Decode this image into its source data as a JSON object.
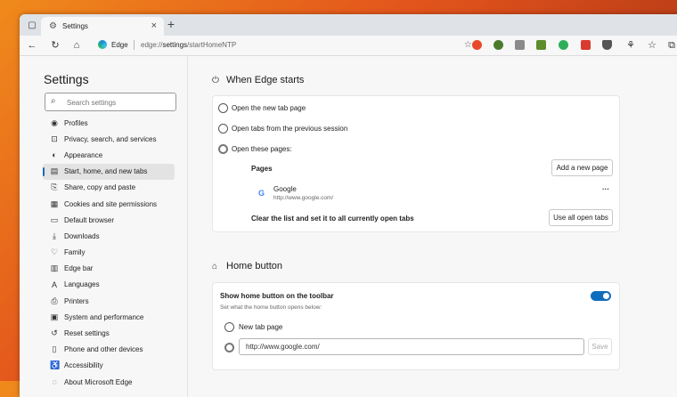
{
  "browser": {
    "tab_title": "Settings",
    "omnibox_label": "Edge",
    "url_scheme": "edge://",
    "url_host": "settings",
    "url_path": "/startHomeNTP"
  },
  "sidebar": {
    "title": "Settings",
    "search_placeholder": "Search settings",
    "items": [
      {
        "label": "Profiles",
        "icon": "profile-icon"
      },
      {
        "label": "Privacy, search, and services",
        "icon": "lock-icon"
      },
      {
        "label": "Appearance",
        "icon": "appearance-icon"
      },
      {
        "label": "Start, home, and new tabs",
        "icon": "start-icon"
      },
      {
        "label": "Share, copy and paste",
        "icon": "share-icon"
      },
      {
        "label": "Cookies and site permissions",
        "icon": "cookie-icon"
      },
      {
        "label": "Default browser",
        "icon": "browser-icon"
      },
      {
        "label": "Downloads",
        "icon": "download-icon"
      },
      {
        "label": "Family",
        "icon": "family-icon"
      },
      {
        "label": "Edge bar",
        "icon": "edge-bar-icon"
      },
      {
        "label": "Languages",
        "icon": "language-icon"
      },
      {
        "label": "Printers",
        "icon": "printer-icon"
      },
      {
        "label": "System and performance",
        "icon": "system-icon"
      },
      {
        "label": "Reset settings",
        "icon": "reset-icon"
      },
      {
        "label": "Phone and other devices",
        "icon": "phone-icon"
      },
      {
        "label": "Accessibility",
        "icon": "accessibility-icon"
      },
      {
        "label": "About Microsoft Edge",
        "icon": "edge-icon"
      }
    ],
    "active_index": 3
  },
  "when_starts": {
    "title": "When Edge starts",
    "option_new_tab": "Open the new tab page",
    "option_prev_session": "Open tabs from the previous session",
    "option_these_pages": "Open these pages:",
    "pages_label": "Pages",
    "add_page_button": "Add a new page",
    "page_name": "Google",
    "page_url": "http://www.google.com/",
    "more_label": "···",
    "clear_label": "Clear the list and set it to all currently open tabs",
    "use_open_tabs_button": "Use all open tabs"
  },
  "home_button": {
    "title": "Home button",
    "show_label": "Show home button on the toolbar",
    "set_label": "Set what the home button opens below:",
    "option_new_tab": "New tab page",
    "url_value": "http://www.google.com/",
    "save_button": "Save"
  },
  "colors": {
    "accent": "#0f6cbd"
  }
}
